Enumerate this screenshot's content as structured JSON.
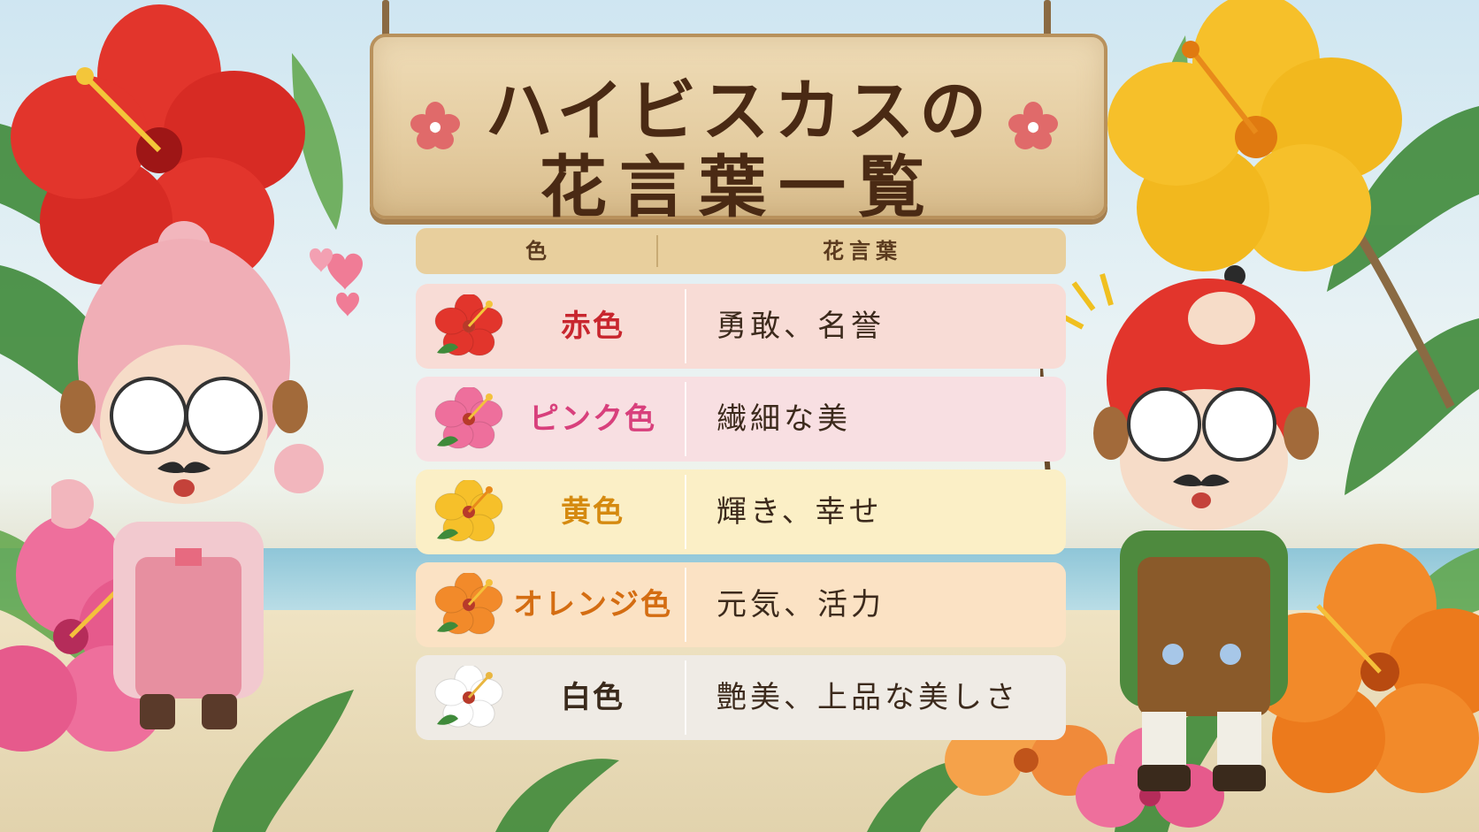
{
  "sign": {
    "line1": "ハイビスカスの",
    "line2": "花言葉一覧"
  },
  "table": {
    "header_color": "色",
    "header_meaning": "花言葉",
    "rows": [
      {
        "color": "赤色",
        "meaning": "勇敢、名誉",
        "text_color": "#c8262e",
        "bg": "#f8dcd6",
        "flower": "#e2352c",
        "center": "#f3c63a"
      },
      {
        "color": "ピンク色",
        "meaning": "繊細な美",
        "text_color": "#d8407c",
        "bg": "#f8dfe2",
        "flower": "#ee6f9c",
        "center": "#f4c13c"
      },
      {
        "color": "黄色",
        "meaning": "輝き、幸せ",
        "text_color": "#d58a10",
        "bg": "#fbefc6",
        "flower": "#f6c02a",
        "center": "#e88a1a"
      },
      {
        "color": "オレンジ色",
        "meaning": "元気、活力",
        "text_color": "#d46d12",
        "bg": "#fbe2c4",
        "flower": "#f28a2a",
        "center": "#f5c03a"
      },
      {
        "color": "白色",
        "meaning": "艶美、上品な美しさ",
        "text_color": "#3a2a1c",
        "bg": "#efebe5",
        "flower": "#ffffff",
        "center": "#e9b640"
      }
    ]
  },
  "colors": {
    "sign_text": "#4a2a14",
    "sign_wood": "#e4cca0",
    "header_bg": "#e8cf9d"
  },
  "icons": [
    "hibiscus-red-icon",
    "hibiscus-pink-icon",
    "hibiscus-yellow-icon",
    "hibiscus-orange-icon",
    "hibiscus-white-icon",
    "heart-icon"
  ]
}
